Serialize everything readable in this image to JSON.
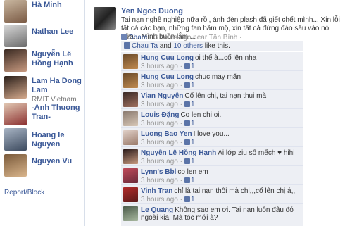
{
  "colors": {
    "link": "#3b5998",
    "panel_bg": "#edeff4",
    "meta": "#999999"
  },
  "friends": [
    {
      "name": "Hà Minh",
      "sub": ""
    },
    {
      "name": "Nathan Lee",
      "sub": ""
    },
    {
      "name": "Nguyễn Lê Hồng Hạnh",
      "sub": ""
    },
    {
      "name": "Lam Ha Dong Lam",
      "sub": "RMIT Vietnam"
    },
    {
      "name": "-Anh Thuong Tran-",
      "sub": ""
    },
    {
      "name": "Hoang le Nguyen",
      "sub": ""
    },
    {
      "name": "Nguyen Vu",
      "sub": ""
    }
  ],
  "report_link": "Report/Block",
  "post": {
    "author": "Yen Ngoc Duong",
    "text": "Tai nạn nghề nghiệp nữa rồi, ánh đèn plash đã giết chết mình... Xin lỗi tất cả các bạn, những fan hâm mộ, xin tất cả đừng đào sâu vào nó nữa... Mình buồn lắm....",
    "share_label": "Share",
    "time": "· 3 hours ago near Tân Bình ·"
  },
  "likes": {
    "names": "Chau Ta",
    "connector": " and ",
    "others": "10 others",
    "suffix": " like this."
  },
  "comments": [
    {
      "name": "Hung Cuu Long",
      "text": "oi thế à...cố lên nha",
      "time": "3 hours ago ·",
      "likes": "1"
    },
    {
      "name": "Hung Cuu Long",
      "text": "chuc may mắn",
      "time": "3 hours ago ·",
      "likes": "1"
    },
    {
      "name": "Vian Nguyễn",
      "text": "Cố lên chị, tai nạn thui mà",
      "time": "3 hours ago ·",
      "likes": "1"
    },
    {
      "name": "Louis Đặng",
      "text": "Co len chi oi.",
      "time": "3 hours ago ·",
      "likes": "1"
    },
    {
      "name": "Luong Bao Yen",
      "text": "I love you...",
      "time": "3 hours ago ·",
      "likes": "1"
    },
    {
      "name": "Nguyễn Lê Hồng Hạnh",
      "text": "Ai lớp ziu số mếch ♥ hihi",
      "time": "3 hours ago ·",
      "likes": "1"
    },
    {
      "name": "Lynn's Bbl",
      "text": "co len em",
      "time": "3 hours ago ·",
      "likes": "1"
    },
    {
      "name": "Vinh Tran",
      "text": "chỉ là tai nạn thôi mà chị,,,cố lên chị á,,",
      "time": "3 hours ago ·",
      "likes": "1"
    },
    {
      "name": "Le Quang",
      "text": "Không sao em ơi. Tai nạn luôn đâu đó ngoài kia. Mà tóc mới à?",
      "time": "",
      "likes": ""
    }
  ]
}
